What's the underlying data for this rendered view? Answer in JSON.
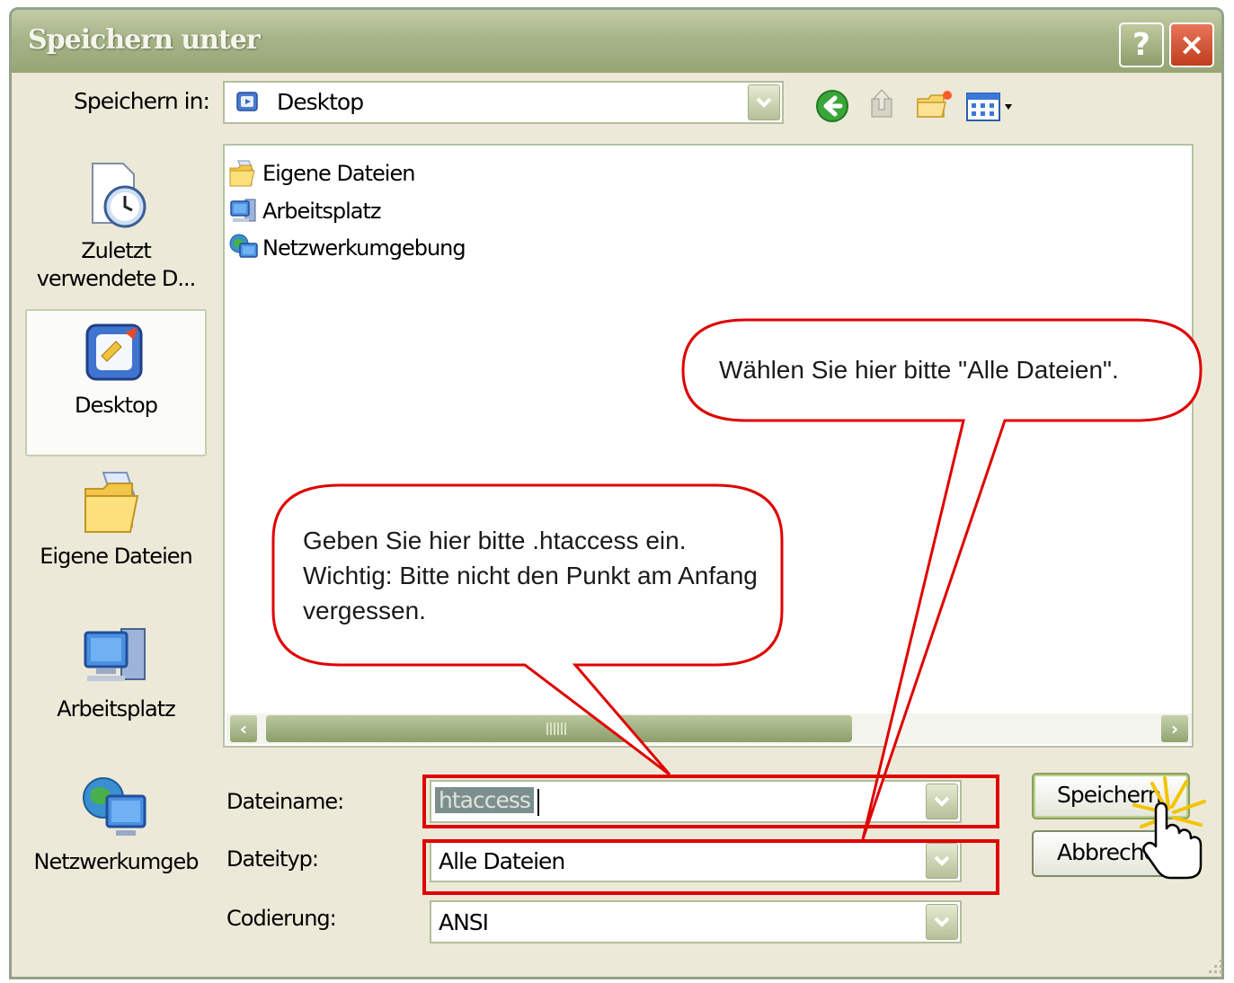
{
  "window": {
    "title": "Speichern unter",
    "help_glyph": "?",
    "close_glyph": "×"
  },
  "toolbar": {
    "save_in_label": "Speichern in:",
    "save_in_value": "Desktop",
    "tools": [
      "back-icon",
      "up-folder-icon",
      "new-folder-icon",
      "views-menu-icon"
    ]
  },
  "places": [
    {
      "label": "Zuletzt verwendete D...",
      "icon": "recent-documents-icon"
    },
    {
      "label": "Desktop",
      "icon": "desktop-icon",
      "selected": true
    },
    {
      "label": "Eigene Dateien",
      "icon": "my-documents-icon"
    },
    {
      "label": "Arbeitsplatz",
      "icon": "my-computer-icon"
    },
    {
      "label": "Netzwerkumgeb",
      "icon": "network-icon"
    }
  ],
  "files": [
    {
      "name": "Eigene Dateien",
      "icon": "my-documents-icon"
    },
    {
      "name": "Arbeitsplatz",
      "icon": "my-computer-icon"
    },
    {
      "name": "Netzwerkumgebung",
      "icon": "network-icon"
    }
  ],
  "form": {
    "filename_label": "Dateiname:",
    "filename_value": "htaccess",
    "filetype_label": "Dateityp:",
    "filetype_value": "Alle Dateien",
    "encoding_label": "Codierung:",
    "encoding_value": "ANSI"
  },
  "buttons": {
    "save": "Speichern",
    "cancel": "Abbrechen"
  },
  "annotations": {
    "callout_1": "Wählen Sie hier bitte \"Alle Dateien\".",
    "callout_2": "Geben Sie hier bitte .htaccess ein. Wichtig: Bitte nicht den Punkt am Anfang vergessen.",
    "color": "#e00000"
  },
  "colors": {
    "title_bar": "#a7b489",
    "dialog_bg": "#ece9d8",
    "accent_green": "#8c9e6b"
  }
}
